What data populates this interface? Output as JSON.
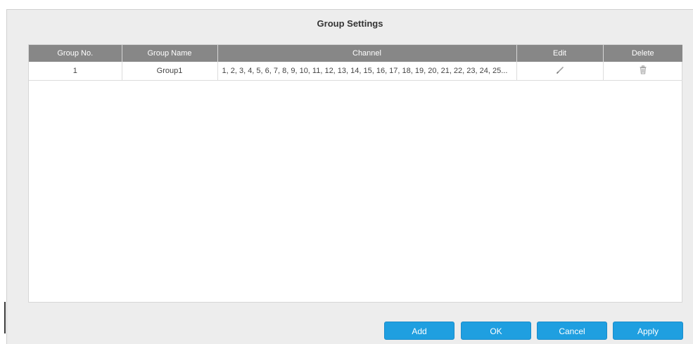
{
  "dialog": {
    "title": "Group Settings"
  },
  "table": {
    "headers": {
      "group_no": "Group No.",
      "group_name": "Group Name",
      "channel": "Channel",
      "edit": "Edit",
      "delete": "Delete"
    },
    "rows": [
      {
        "group_no": "1",
        "group_name": "Group1",
        "channel": "1, 2, 3, 4, 5, 6, 7, 8, 9, 10, 11, 12, 13, 14, 15, 16, 17, 18, 19, 20, 21, 22, 23, 24, 25...",
        "edit_icon": "pencil-icon",
        "delete_icon": "trash-icon"
      }
    ]
  },
  "buttons": {
    "add": "Add",
    "ok": "OK",
    "cancel": "Cancel",
    "apply": "Apply"
  },
  "colors": {
    "header_bg": "#878787",
    "button_bg": "#1f9fe0",
    "dialog_bg": "#ededed"
  }
}
